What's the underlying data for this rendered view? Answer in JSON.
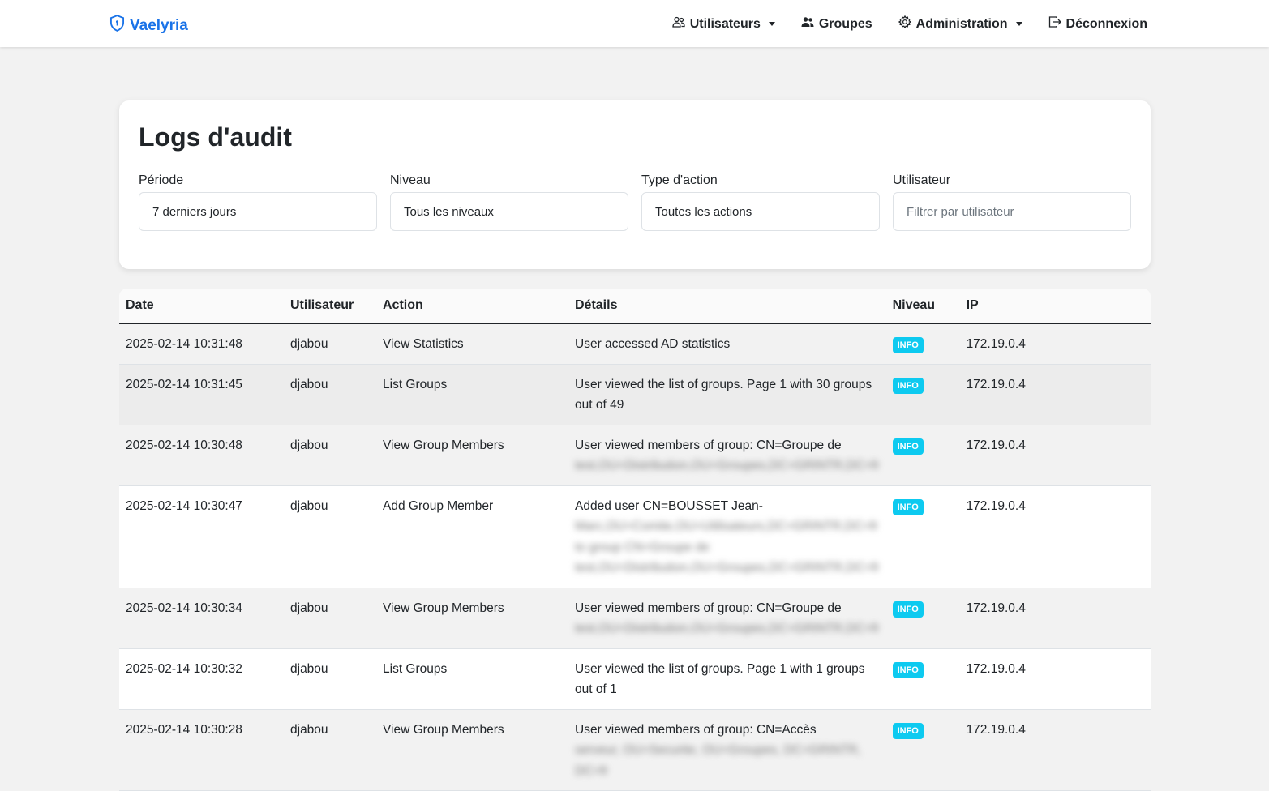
{
  "nav": {
    "brand": "Vaelyria",
    "items": [
      {
        "label": "Utilisateurs",
        "dropdown": true
      },
      {
        "label": "Groupes",
        "dropdown": false
      },
      {
        "label": "Administration",
        "dropdown": true
      },
      {
        "label": "Déconnexion",
        "dropdown": false
      }
    ]
  },
  "page": {
    "title": "Logs d'audit"
  },
  "filters": {
    "period": {
      "label": "Période",
      "value": "7 derniers jours"
    },
    "level": {
      "label": "Niveau",
      "value": "Tous les niveaux"
    },
    "action_type": {
      "label": "Type d'action",
      "value": "Toutes les actions"
    },
    "user": {
      "label": "Utilisateur",
      "placeholder": "Filtrer par utilisateur"
    }
  },
  "table": {
    "headers": [
      "Date",
      "Utilisateur",
      "Action",
      "Détails",
      "Niveau",
      "IP"
    ],
    "rows": [
      {
        "date": "2025-02-14 10:31:48",
        "user": "djabou",
        "action": "View Statistics",
        "details": "User accessed AD statistics",
        "details_blurred": "",
        "level": "INFO",
        "ip": "172.19.0.4"
      },
      {
        "date": "2025-02-14 10:31:45",
        "user": "djabou",
        "action": "List Groups",
        "details": "User viewed the list of groups. Page 1 with 30 groups out of 49",
        "details_blurred": "",
        "level": "INFO",
        "ip": "172.19.0.4"
      },
      {
        "date": "2025-02-14 10:30:48",
        "user": "djabou",
        "action": "View Group Members",
        "details": "User viewed members of group: CN=Groupe de",
        "details_blurred": "test,OU=Distribution,OU=Groupes,DC=GRINTR,DC=fr",
        "level": "INFO",
        "ip": "172.19.0.4"
      },
      {
        "date": "2025-02-14 10:30:47",
        "user": "djabou",
        "action": "Add Group Member",
        "details": "Added user CN=BOUSSET Jean-",
        "details_blurred": "Marc,OU=Comite,OU=Utilisateurs,DC=GRINTR,DC=fr to group CN=Groupe de test,OU=Distribution,OU=Groupes,DC=GRINTR,DC=fr",
        "level": "INFO",
        "ip": "172.19.0.4"
      },
      {
        "date": "2025-02-14 10:30:34",
        "user": "djabou",
        "action": "View Group Members",
        "details": "User viewed members of group: CN=Groupe de",
        "details_blurred": "test,OU=Distribution,OU=Groupes,DC=GRINTR,DC=fr",
        "level": "INFO",
        "ip": "172.19.0.4"
      },
      {
        "date": "2025-02-14 10:30:32",
        "user": "djabou",
        "action": "List Groups",
        "details": "User viewed the list of groups. Page 1 with 1 groups out of 1",
        "details_blurred": "",
        "level": "INFO",
        "ip": "172.19.0.4"
      },
      {
        "date": "2025-02-14 10:30:28",
        "user": "djabou",
        "action": "View Group Members",
        "details": "User viewed members of group: CN=Accès",
        "details_blurred": "serveur, OU=Securite, OU=Groupes, DC=GRINTR, DC=fr",
        "level": "INFO",
        "ip": "172.19.0.4"
      }
    ]
  },
  "colors": {
    "brand": "#1a73e8",
    "badge_info": "#0dcaf0"
  }
}
